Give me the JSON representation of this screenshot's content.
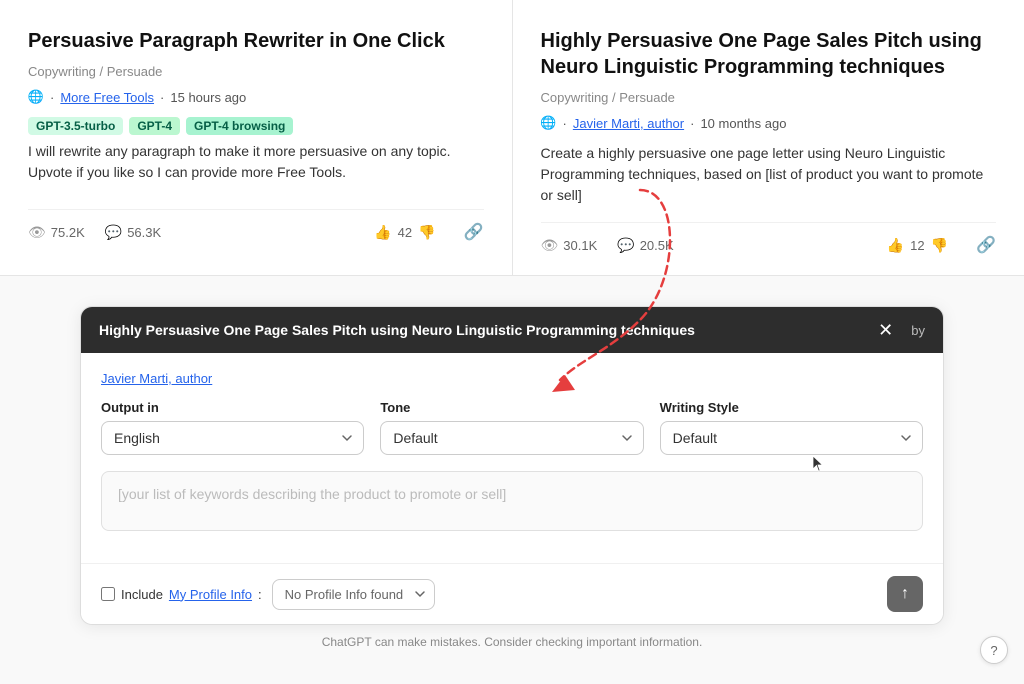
{
  "cards": [
    {
      "id": "card1",
      "title": "Persuasive Paragraph Rewriter in One Click",
      "category": "Copywriting / Persuade",
      "meta_author": "More Free Tools",
      "meta_time": "15 hours ago",
      "tags": [
        "GPT-3.5-turbo",
        "GPT-4",
        "GPT-4 browsing"
      ],
      "description": "I will rewrite any paragraph to make it more persuasive on any topic. Upvote if you like so I can provide more Free Tools.",
      "views": "75.2K",
      "comments": "56.3K",
      "votes": "42"
    },
    {
      "id": "card2",
      "title": "Highly Persuasive One Page Sales Pitch using Neuro Linguistic Programming techniques",
      "category": "Copywriting / Persuade",
      "meta_author": "Javier Marti, author",
      "meta_time": "10 months ago",
      "description": "Create a highly persuasive one page letter using Neuro Linguistic Programming techniques, based on [list of product you want to promote or sell]",
      "views": "30.1K",
      "comments": "20.5K",
      "votes": "12"
    }
  ],
  "panel": {
    "title": "Highly Persuasive One Page Sales Pitch using Neuro Linguistic Programming techniques",
    "by_label": "by",
    "author": "Javier Marti, author",
    "output_label": "Output in",
    "output_value": "English",
    "tone_label": "Tone",
    "tone_value": "Default",
    "writing_style_label": "Writing Style",
    "writing_style_value": "Default",
    "keyword_placeholder": "[your list of keywords describing the product to promote or sell]",
    "profile_label": "Include",
    "profile_link": "My Profile Info",
    "profile_colon": ":",
    "profile_select": "No Profile Info found",
    "bottom_notice": "ChatGPT can make mistakes. Consider checking important information."
  },
  "icons": {
    "globe": "🌐",
    "eye": "👁",
    "comment": "💬",
    "thumbup": "👍",
    "thumbdown": "👎",
    "link": "🔗",
    "close": "✕",
    "arrow_up": "↑",
    "question": "?"
  }
}
